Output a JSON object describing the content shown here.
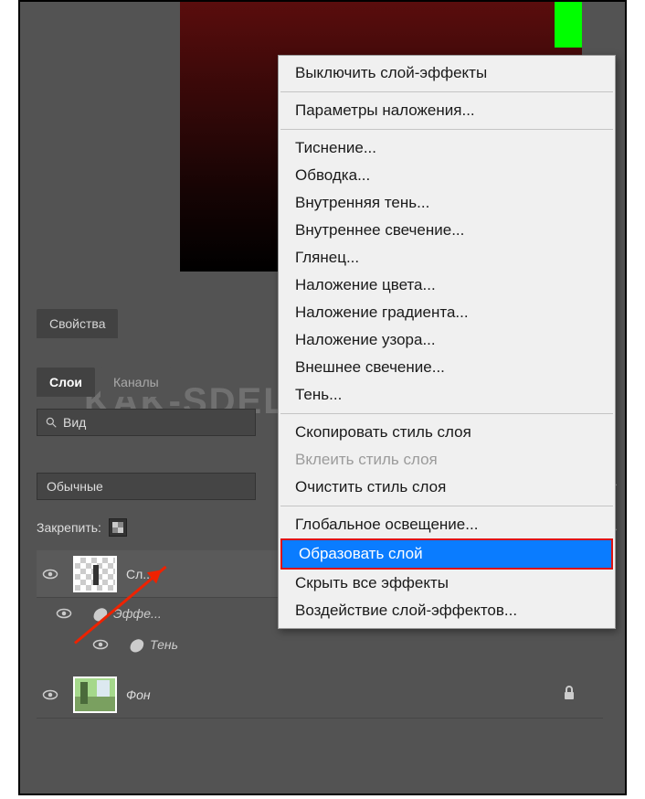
{
  "watermark": "KAK-SDELAT.ORG",
  "panels": {
    "properties_label": "Свойства",
    "layers_label": "Слои",
    "channels_label": "Каналы",
    "kind_label": "Вид",
    "blend_mode": "Обычные",
    "lock_label": "Закрепить:"
  },
  "layers": {
    "layer1_name": "Сл...",
    "effects_label": "Эффе...",
    "shadow_label": "Тень",
    "background_name": "Фон"
  },
  "context_menu": {
    "disable_effects": "Выключить слой-эффекты",
    "blending_options": "Параметры наложения...",
    "bevel": "Тиснение...",
    "stroke": "Обводка...",
    "inner_shadow": "Внутренняя тень...",
    "inner_glow": "Внутреннее свечение...",
    "satin": "Глянец...",
    "color_overlay": "Наложение цвета...",
    "gradient_overlay": "Наложение градиента...",
    "pattern_overlay": "Наложение узора...",
    "outer_glow": "Внешнее свечение...",
    "drop_shadow": "Тень...",
    "copy_style": "Скопировать стиль слоя",
    "paste_style": "Вклеить стиль слоя",
    "clear_style": "Очистить стиль слоя",
    "global_light": "Глобальное освещение...",
    "create_layer": "Образовать слой",
    "hide_all": "Скрыть все эффекты",
    "scale_effects": "Воздействие слой-эффектов..."
  }
}
